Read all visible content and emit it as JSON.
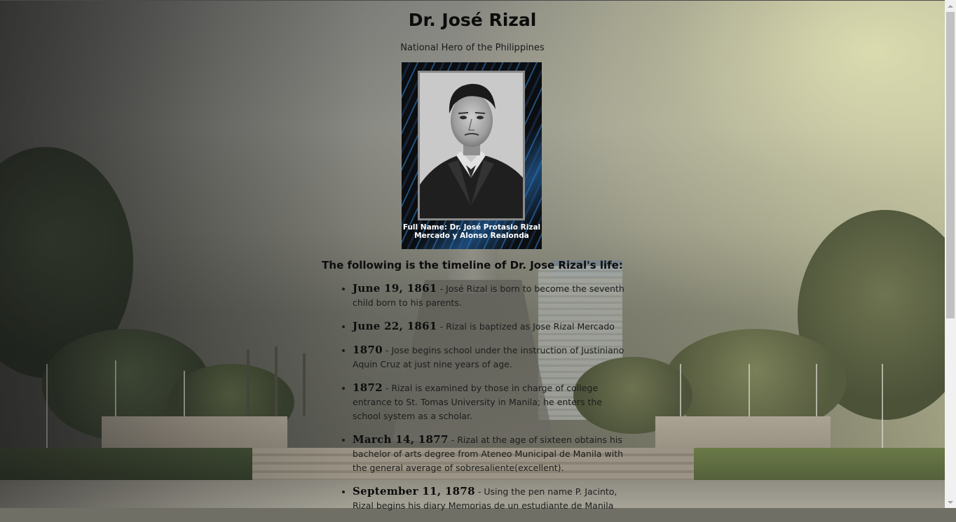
{
  "page": {
    "title": "Dr. José Rizal",
    "subtitle": "National Hero of the Philippines"
  },
  "portrait": {
    "caption": "Full Name: Dr. José Protasio Rizal Mercado y Alonso Realonda"
  },
  "timeline": {
    "heading": "The following is the timeline of Dr. Jose Rizal's life:",
    "separator": "-",
    "items": [
      {
        "date": "June 19, 1861",
        "text": "José Rizal is born to become the seventh child born to his parents."
      },
      {
        "date": "June 22, 1861",
        "text": "Rizal is baptized as Jose Rizal Mercado"
      },
      {
        "date": "1870",
        "text": "Jose begins school under the instruction of Justiniano Aquin Cruz at just nine years of age."
      },
      {
        "date": "1872",
        "text": "Rizal is examined by those in charge of college entrance to St. Tomas University in Manila; he enters the school system as a scholar."
      },
      {
        "date": "March 14, 1877",
        "text": "Rizal at the age of sixteen obtains his bachelor of arts degree from Ateneo Municipal de Manila with the general average of sobresaliente(excellent)."
      },
      {
        "date": "September 11, 1878",
        "text": "Using the pen name P. Jacinto, Rizal begins his diary Memorias de un estudiante de Manila"
      }
    ]
  },
  "colors": {
    "title": "#0c0c0c",
    "body_text": "#1d1d1d",
    "caption_text": "#ffffff",
    "scrollbar_track": "#f1f1f1",
    "scrollbar_thumb": "#c1c1c1"
  }
}
